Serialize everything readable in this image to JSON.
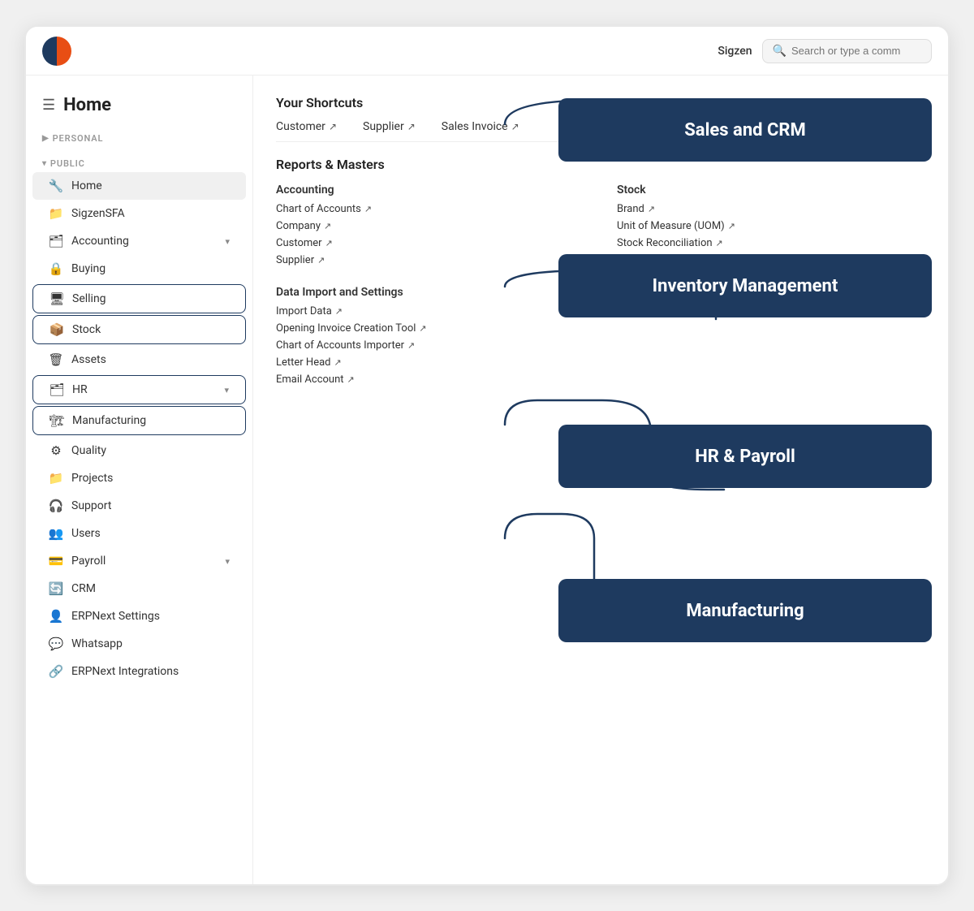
{
  "topbar": {
    "user": "Sigzen",
    "search_placeholder": "Search or type a comm"
  },
  "sidebar": {
    "page_title": "Home",
    "personal_label": "PERSONAL",
    "public_label": "PUBLIC",
    "items": [
      {
        "id": "home",
        "label": "Home",
        "icon": "🔧",
        "active": true
      },
      {
        "id": "sigzensfa",
        "label": "SigzenSFA",
        "icon": "📁"
      },
      {
        "id": "accounting",
        "label": "Accounting",
        "icon": "🗂",
        "has_chevron": true
      },
      {
        "id": "buying",
        "label": "Buying",
        "icon": "🔒"
      },
      {
        "id": "selling",
        "label": "Selling",
        "icon": "🖥",
        "outlined": true
      },
      {
        "id": "stock",
        "label": "Stock",
        "icon": "📦",
        "outlined": true
      },
      {
        "id": "assets",
        "label": "Assets",
        "icon": "🗑"
      },
      {
        "id": "hr",
        "label": "HR",
        "icon": "🗂",
        "has_chevron": true,
        "outlined": true
      },
      {
        "id": "manufacturing",
        "label": "Manufacturing",
        "icon": "🏗",
        "outlined": true
      },
      {
        "id": "quality",
        "label": "Quality",
        "icon": "⚙"
      },
      {
        "id": "projects",
        "label": "Projects",
        "icon": "📁"
      },
      {
        "id": "support",
        "label": "Support",
        "icon": "🎧"
      },
      {
        "id": "users",
        "label": "Users",
        "icon": "👥"
      },
      {
        "id": "payroll",
        "label": "Payroll",
        "icon": "💳",
        "has_chevron": true
      },
      {
        "id": "crm",
        "label": "CRM",
        "icon": "🔄"
      },
      {
        "id": "erpnext-settings",
        "label": "ERPNext Settings",
        "icon": "👤"
      },
      {
        "id": "whatsapp",
        "label": "Whatsapp",
        "icon": "💚",
        "is_whatsapp": true
      },
      {
        "id": "erpnext-integrations",
        "label": "ERPNext Integrations",
        "icon": "🔗"
      }
    ]
  },
  "content": {
    "shortcuts_title": "Your Shortcuts",
    "shortcuts": [
      {
        "label": "Customer",
        "arrow": "↗"
      },
      {
        "label": "Supplier",
        "arrow": "↗"
      },
      {
        "label": "Sales Invoice",
        "arrow": "↗"
      }
    ],
    "reports_title": "Reports & Masters",
    "accounting_col_title": "Accounting",
    "accounting_links": [
      {
        "label": "Chart of Accounts",
        "arrow": "↗"
      },
      {
        "label": "Company",
        "arrow": "↗"
      },
      {
        "label": "Customer",
        "arrow": "↗"
      },
      {
        "label": "Supplier",
        "arrow": "↗"
      }
    ],
    "stock_col_title": "Stock",
    "stock_links": [
      {
        "label": "Brand",
        "arrow": "↗"
      },
      {
        "label": "Unit of Measure (UOM)",
        "arrow": "↗"
      },
      {
        "label": "Stock Reconciliation",
        "arrow": "↗"
      }
    ],
    "data_import_title": "Data Import and Settings",
    "data_import_links": [
      {
        "label": "Import Data",
        "arrow": "↗"
      },
      {
        "label": "Opening Invoice Creation Tool",
        "arrow": "↗"
      },
      {
        "label": "Chart of Accounts Importer",
        "arrow": "↗"
      },
      {
        "label": "Letter Head",
        "arrow": "↗"
      },
      {
        "label": "Email Account",
        "arrow": "↗"
      }
    ],
    "tooltips": [
      {
        "id": "sales-crm",
        "label": "Sales and CRM"
      },
      {
        "id": "inventory-management",
        "label": "Inventory Management"
      },
      {
        "id": "hr-payroll",
        "label": "HR & Payroll"
      },
      {
        "id": "manufacturing",
        "label": "Manufacturing"
      }
    ]
  }
}
